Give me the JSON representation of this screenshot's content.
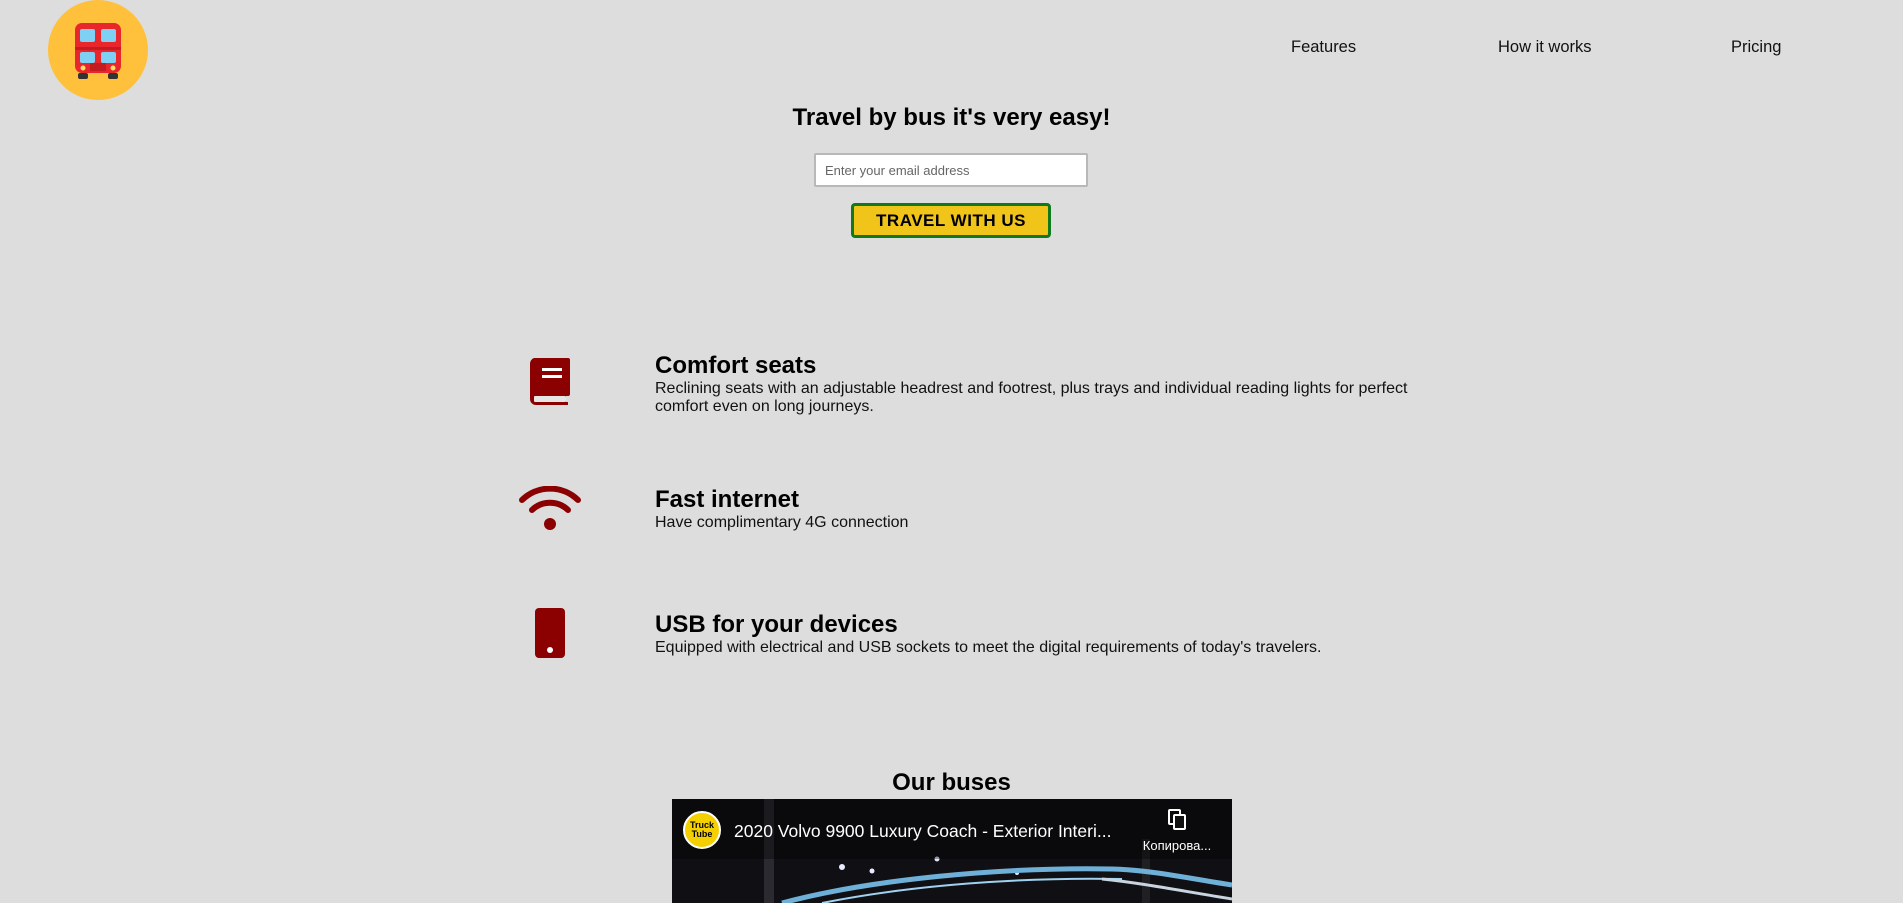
{
  "header": {
    "logo_icon": "double-decker-bus-icon",
    "logo_bg": "#ffc03c",
    "nav": [
      {
        "label": "Features"
      },
      {
        "label": "How it works"
      },
      {
        "label": "Pricing"
      }
    ]
  },
  "hero": {
    "title": "Travel by bus it's very easy!",
    "email_placeholder": "Enter your email address",
    "cta_label": "TRAVEL WITH US",
    "cta_bg": "#f0c419",
    "cta_border": "#0f7a1d"
  },
  "features": [
    {
      "icon": "book-icon",
      "title": "Comfort seats",
      "desc": "Reclining seats with an adjustable headrest and footrest, plus trays and individual reading lights for perfect comfort even on long journeys."
    },
    {
      "icon": "wifi-icon",
      "title": "Fast internet",
      "desc": "Have complimentary 4G connection"
    },
    {
      "icon": "mobile-phone-icon",
      "title": "USB for your devices",
      "desc": "Equipped with electrical and USB sockets to meet the digital requirements of today's travelers."
    }
  ],
  "icon_color": "#8b0000",
  "buses": {
    "title": "Our buses",
    "video": {
      "channel_badge_line1": "Truck",
      "channel_badge_line2": "Tube",
      "title": "2020 Volvo 9900 Luxury Coach - Exterior Interi...",
      "copy_icon": "copy-icon",
      "copy_label": "Копирова..."
    }
  }
}
